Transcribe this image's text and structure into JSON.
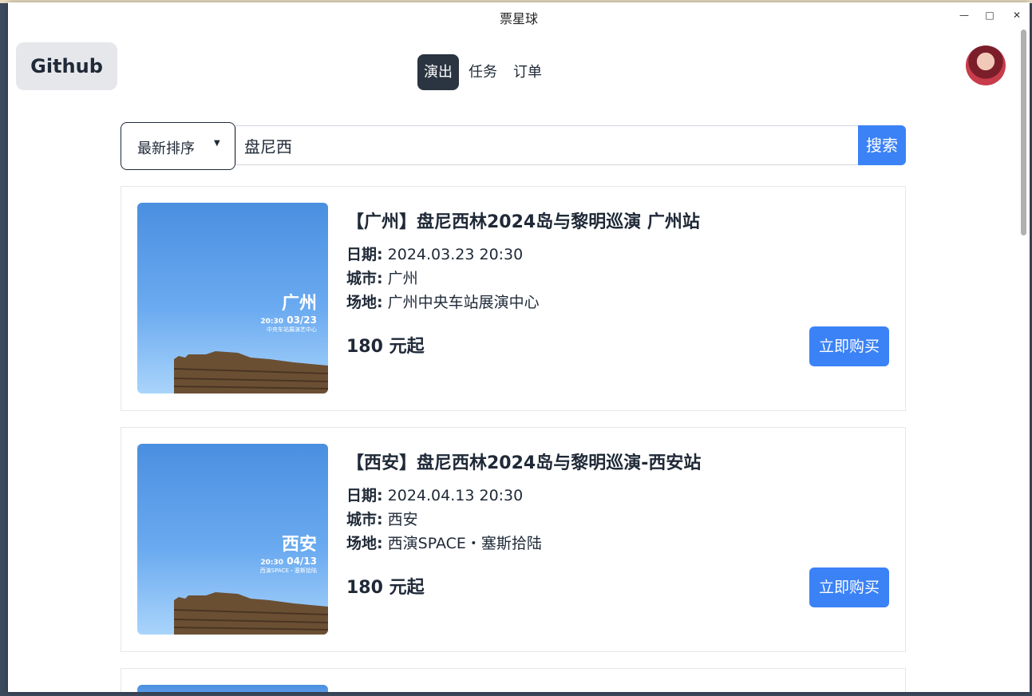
{
  "window": {
    "title": "票星球",
    "minimize_icon": "minimize-icon",
    "maximize_icon": "maximize-icon",
    "close_icon": "close-icon"
  },
  "header": {
    "github_label": "Github",
    "nav_tabs": [
      {
        "label": "演出",
        "active": true
      },
      {
        "label": "任务",
        "active": false
      },
      {
        "label": "订单",
        "active": false
      }
    ]
  },
  "search": {
    "sort_selected": "最新排序",
    "query": "盘尼西",
    "button_label": "搜索"
  },
  "labels": {
    "date": "日期:",
    "city": "城市:",
    "venue": "场地:",
    "buy": "立即购买"
  },
  "events": [
    {
      "title": "【广州】盘尼西林2024岛与黎明巡演 广州站",
      "date": "2024.03.23 20:30",
      "city": "广州",
      "venue": "广州中央车站展演中心",
      "price": "180 元起",
      "poster": {
        "city": "广州",
        "time": "20:30",
        "date": "03/23",
        "venue": "中央车站展演艺中心"
      }
    },
    {
      "title": "【西安】盘尼西林2024岛与黎明巡演-西安站",
      "date": "2024.04.13 20:30",
      "city": "西安",
      "venue": "西演SPACE・塞斯拾陆",
      "price": "180 元起",
      "poster": {
        "city": "西安",
        "time": "20:30",
        "date": "04/13",
        "venue": "西演SPACE・塞斯拾陆"
      }
    }
  ],
  "colors": {
    "primary": "#3b82f6",
    "nav_active_bg": "#2b3441",
    "github_bg": "#e5e7eb"
  }
}
